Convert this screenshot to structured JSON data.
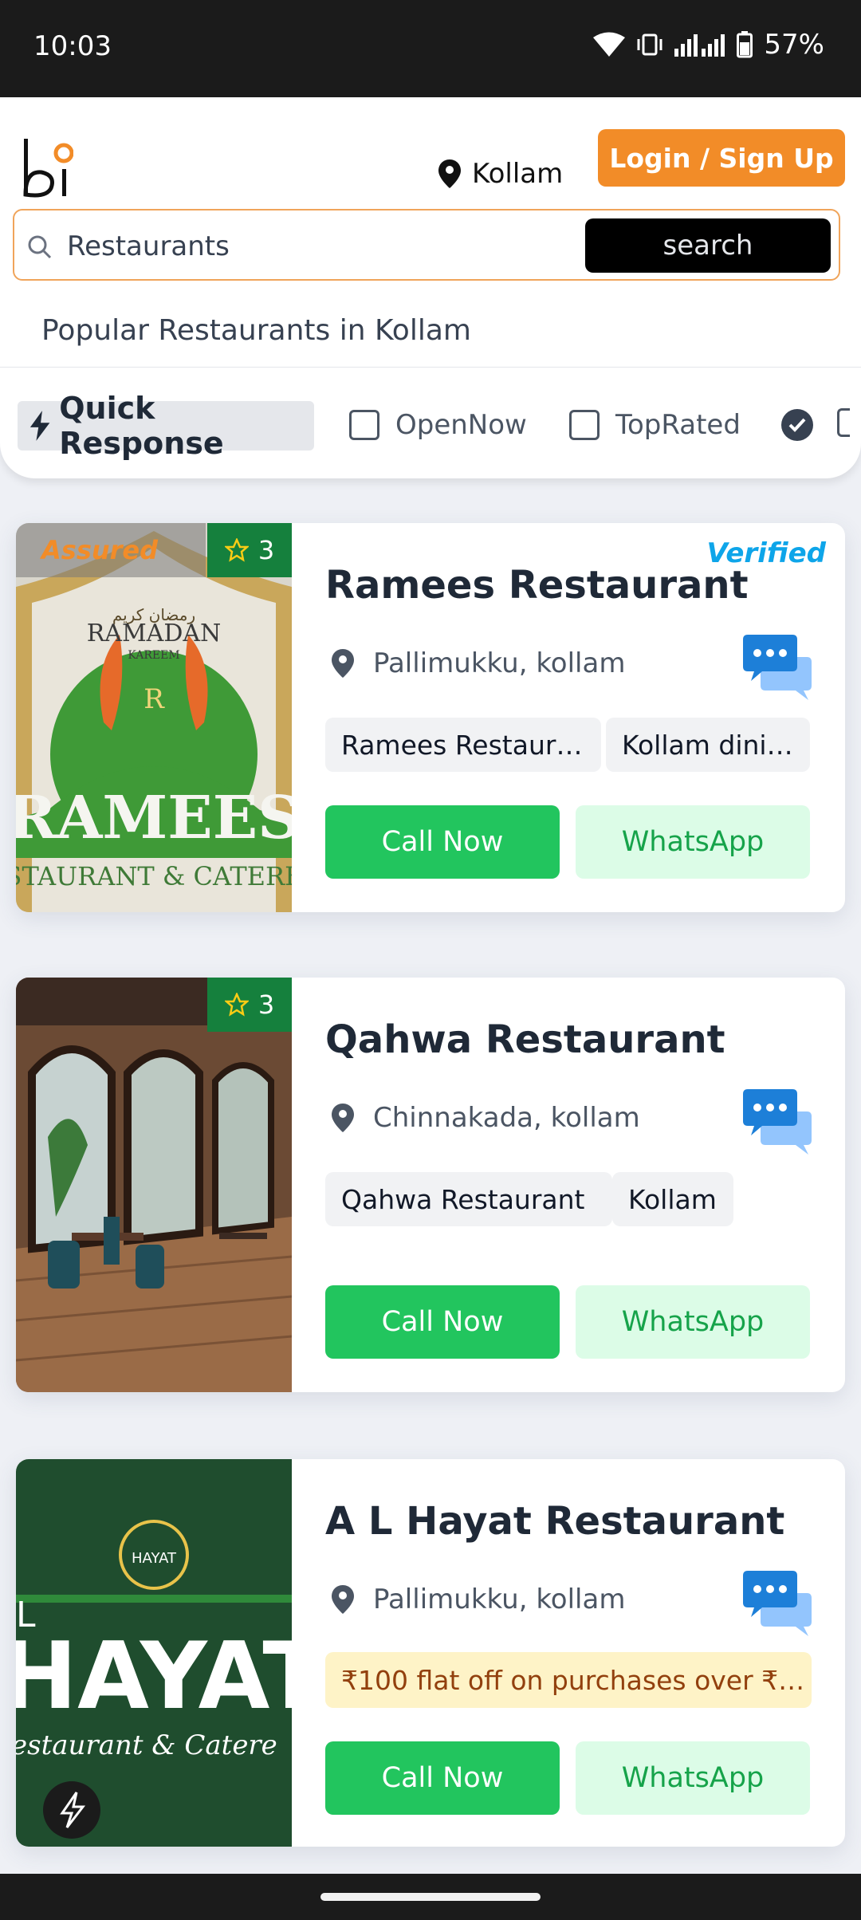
{
  "status_bar": {
    "time": "10:03",
    "battery": "57%"
  },
  "header": {
    "logo_text": "bi",
    "location": "Kollam",
    "login_label": "Login / Sign Up"
  },
  "search": {
    "value": "Restaurants",
    "button_label": "search"
  },
  "section_title": "Popular Restaurants in Kollam",
  "filters": {
    "quick_response": "Quick Response",
    "open_now": "OpenNow",
    "top_rated": "TopRated"
  },
  "listings": [
    {
      "name": "Ramees Restaurant",
      "rating": "3",
      "assured": "Assured",
      "verified": "Verified",
      "address": "Pallimukku, kollam",
      "tags": [
        "Ramees Restaur…",
        "Kollam dini…"
      ],
      "image_text": {
        "top": "رمضان كريم",
        "mid": "RAMADAN",
        "small": "KAREEM",
        "big": "RAMEES",
        "sub": "STAURANT & CATERE"
      },
      "call_label": "Call Now",
      "whatsapp_label": "WhatsApp"
    },
    {
      "name": "Qahwa Restaurant",
      "rating": "3",
      "address": "Chinnakada, kollam",
      "tags": [
        "Qahwa Restaurant",
        "Kollam"
      ],
      "call_label": "Call Now",
      "whatsapp_label": "WhatsApp"
    },
    {
      "name": "A L Hayat Restaurant",
      "address": "Pallimukku, kollam",
      "offer": "₹100 flat off on purchases over ₹…",
      "image_text": {
        "logo": "HAYAT",
        "big": "HAYAT",
        "letter": "L",
        "sub": "estaurant & Catere"
      },
      "call_label": "Call Now",
      "whatsapp_label": "WhatsApp"
    }
  ],
  "colors": {
    "accent": "#f28c28",
    "call": "#22c55e",
    "whatsapp_bg": "#dcfce7",
    "rating": "#15803d",
    "verified": "#0ea5e9"
  }
}
